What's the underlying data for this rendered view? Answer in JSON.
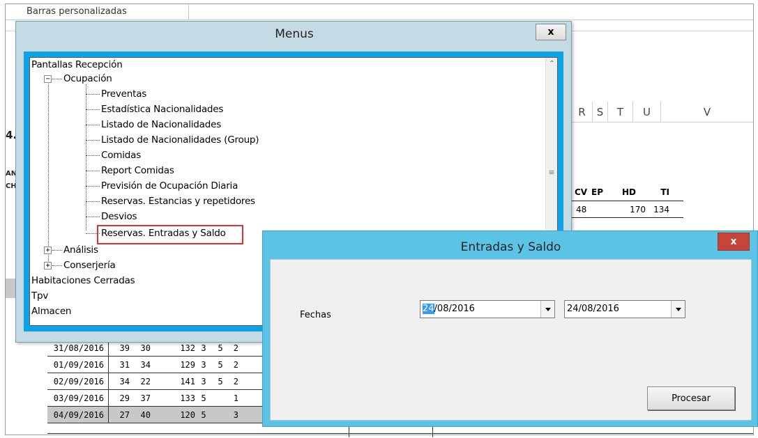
{
  "sheet": {
    "tab_label": "Barras personalizadas",
    "col_headers": [
      "R",
      "S",
      "T",
      "U",
      "V"
    ],
    "left_fragments": [
      "4.",
      "AN",
      "CH"
    ],
    "right_table": {
      "headers": [
        "CV",
        "EP",
        "HD",
        "TI"
      ],
      "rows": [
        [
          "48",
          "",
          "170",
          "134"
        ]
      ]
    },
    "bottom_rows": [
      {
        "date": "31/08/2016",
        "a": "39",
        "b": "30",
        "c": "132",
        "d": "3",
        "e": "5",
        "f": "2",
        "highlight": false
      },
      {
        "date": "01/09/2016",
        "a": "31",
        "b": "34",
        "c": "129",
        "d": "3",
        "e": "5",
        "f": "2",
        "highlight": false
      },
      {
        "date": "02/09/2016",
        "a": "34",
        "b": "22",
        "c": "141",
        "d": "3",
        "e": "5",
        "f": "2",
        "highlight": false
      },
      {
        "date": "03/09/2016",
        "a": "29",
        "b": "37",
        "c": "133",
        "d": "5",
        "e": "",
        "f": "1",
        "highlight": false
      },
      {
        "date": "04/09/2016",
        "a": "27",
        "b": "40",
        "c": "120",
        "d": "5",
        "e": "",
        "f": "3",
        "highlight": true
      }
    ]
  },
  "menus": {
    "title": "Menus",
    "close_label": "x",
    "tree": {
      "root_pantallas": "Pantallas Recepción",
      "ocupacion": "Ocupación",
      "ocupacion_children": [
        "Preventas",
        "Estadística Nacionalidades",
        "Listado de Nacionalidades",
        "Listado de Nacionalidades (Group)",
        "Comidas",
        "Report Comidas",
        "Previsión de Ocupación Diaria",
        "Reservas. Estancias y repetidores",
        "Desvios",
        "Reservas. Entradas y Saldo"
      ],
      "analisis": "Análisis",
      "conserjeria": "Conserjería",
      "habitaciones": "Habitaciones Cerradas",
      "tpv": "Tpv",
      "almacen": "Almacen"
    }
  },
  "entradas": {
    "title": "Entradas y Saldo",
    "close_label": "x",
    "fechas_label": "Fechas",
    "date_from": {
      "selected_part": "24",
      "rest": "/08/2016"
    },
    "date_to": "24/08/2016",
    "procesar_label": "Procesar"
  }
}
